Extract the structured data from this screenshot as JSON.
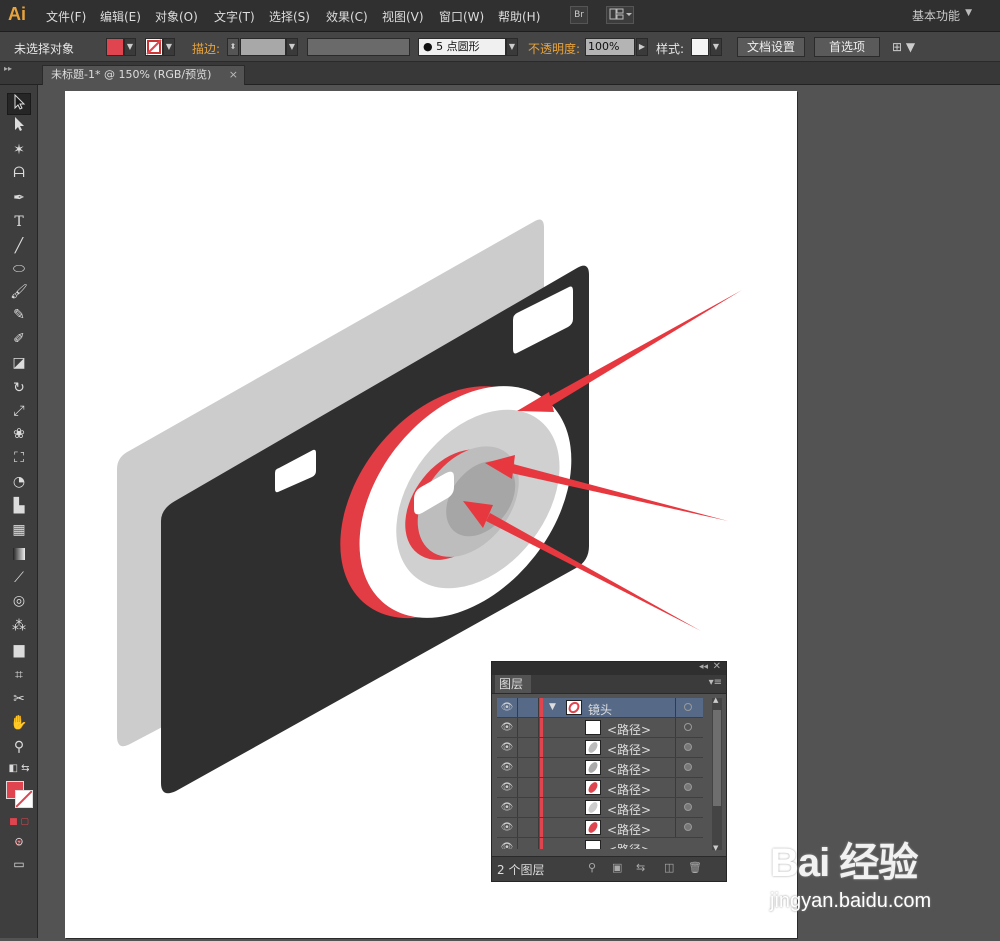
{
  "app": {
    "logo": "Ai",
    "menus": [
      "文件(F)",
      "编辑(E)",
      "对象(O)",
      "文字(T)",
      "选择(S)",
      "效果(C)",
      "视图(V)",
      "窗口(W)",
      "帮助(H)"
    ],
    "bridge_label": "Br",
    "workspace": "基本功能"
  },
  "control_bar": {
    "selection_status": "未选择对象",
    "stroke_label": "描边:",
    "brush_value": "5 点圆形",
    "opacity_label": "不透明度:",
    "opacity_value": "100%",
    "style_label": "样式:",
    "doc_setup_button": "文档设置",
    "prefs_button": "首选项",
    "fill_color": "#e0454f"
  },
  "document": {
    "tab_title": "未标题-1* @ 150% (RGB/预览)",
    "close_glyph": "×"
  },
  "tools": [
    "selection-tool",
    "direct-selection-tool",
    "magic-wand-tool",
    "lasso-tool",
    "pen-tool",
    "type-tool",
    "line-tool",
    "ellipse-tool",
    "paintbrush-tool",
    "pencil-tool",
    "blob-brush-tool",
    "eraser-tool",
    "rotate-tool",
    "scale-tool",
    "warp-tool",
    "free-transform-tool",
    "shape-builder-tool",
    "perspective-grid-tool",
    "mesh-tool",
    "gradient-tool",
    "eyedropper-tool",
    "blend-tool",
    "symbol-sprayer-tool",
    "column-graph-tool",
    "artboard-tool",
    "slice-tool",
    "hand-tool",
    "zoom-tool"
  ],
  "layers_panel": {
    "title": "图层",
    "parent_layer": "镜头",
    "rows": [
      {
        "name": "<路径>",
        "thumb": "white"
      },
      {
        "name": "<路径>",
        "thumb": "gray"
      },
      {
        "name": "<路径>",
        "thumb": "gray"
      },
      {
        "name": "<路径>",
        "thumb": "red"
      },
      {
        "name": "<路径>",
        "thumb": "gray"
      },
      {
        "name": "<路径>",
        "thumb": "red"
      },
      {
        "name": "<路径>",
        "thumb": "white"
      }
    ],
    "layer_count": "2 个图层",
    "layer_color": "#e0454f"
  },
  "watermark": {
    "brand": "Bai 经验",
    "url": "jingyan.baidu.com"
  },
  "colors": {
    "camera_body": "#2f2f2f",
    "camera_back": "#cccccc",
    "accent_red": "#e23c44",
    "lens_gray": "#bdbdbd"
  }
}
